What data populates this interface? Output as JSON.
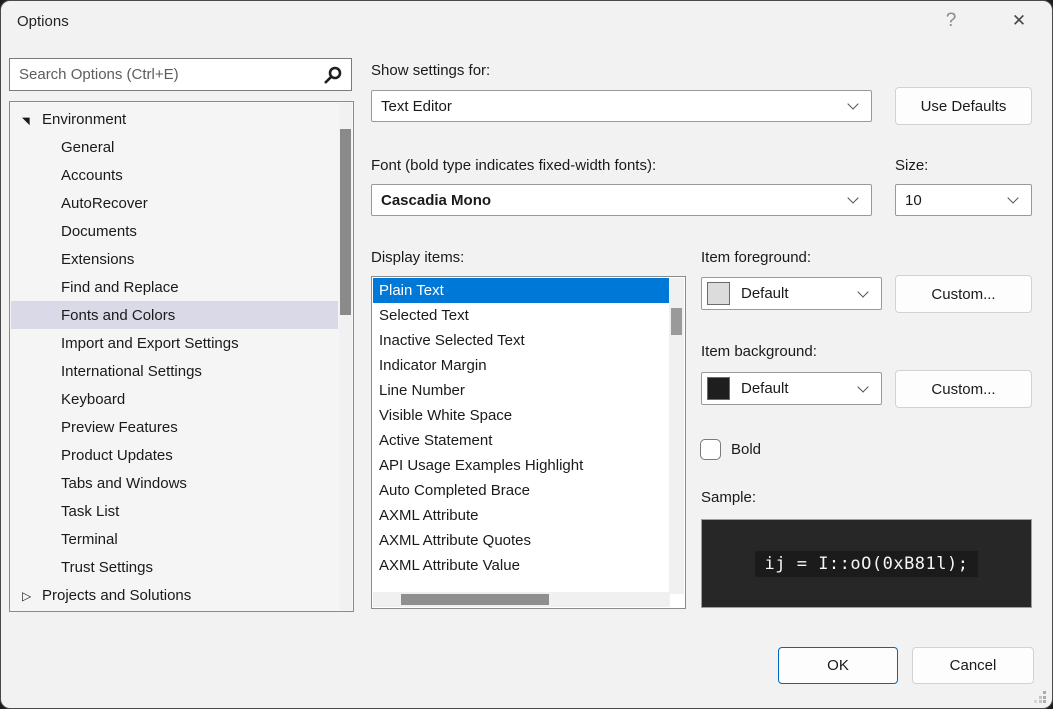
{
  "window": {
    "title": "Options",
    "help_icon": "?",
    "close_icon": "✕"
  },
  "search": {
    "placeholder": "Search Options (Ctrl+E)"
  },
  "tree": {
    "items": [
      {
        "label": "Environment",
        "level": 0,
        "arrow": "expanded",
        "selected": false
      },
      {
        "label": "General",
        "level": 1,
        "arrow": "none",
        "selected": false
      },
      {
        "label": "Accounts",
        "level": 1,
        "arrow": "none",
        "selected": false
      },
      {
        "label": "AutoRecover",
        "level": 1,
        "arrow": "none",
        "selected": false
      },
      {
        "label": "Documents",
        "level": 1,
        "arrow": "none",
        "selected": false
      },
      {
        "label": "Extensions",
        "level": 1,
        "arrow": "none",
        "selected": false
      },
      {
        "label": "Find and Replace",
        "level": 1,
        "arrow": "none",
        "selected": false
      },
      {
        "label": "Fonts and Colors",
        "level": 1,
        "arrow": "none",
        "selected": true
      },
      {
        "label": "Import and Export Settings",
        "level": 1,
        "arrow": "none",
        "selected": false
      },
      {
        "label": "International Settings",
        "level": 1,
        "arrow": "none",
        "selected": false
      },
      {
        "label": "Keyboard",
        "level": 1,
        "arrow": "none",
        "selected": false
      },
      {
        "label": "Preview Features",
        "level": 1,
        "arrow": "none",
        "selected": false
      },
      {
        "label": "Product Updates",
        "level": 1,
        "arrow": "none",
        "selected": false
      },
      {
        "label": "Tabs and Windows",
        "level": 1,
        "arrow": "none",
        "selected": false
      },
      {
        "label": "Task List",
        "level": 1,
        "arrow": "none",
        "selected": false
      },
      {
        "label": "Terminal",
        "level": 1,
        "arrow": "none",
        "selected": false
      },
      {
        "label": "Trust Settings",
        "level": 1,
        "arrow": "none",
        "selected": false
      },
      {
        "label": "Projects and Solutions",
        "level": 0,
        "arrow": "collapsed",
        "selected": false
      }
    ]
  },
  "settings": {
    "show_settings_label": "Show settings for:",
    "show_settings_value": "Text Editor",
    "use_defaults_label": "Use Defaults",
    "font_label": "Font (bold type indicates fixed-width fonts):",
    "font_value": "Cascadia Mono",
    "size_label": "Size:",
    "size_value": "10"
  },
  "display_items": {
    "label": "Display items:",
    "items": [
      {
        "label": "Plain Text",
        "selected": true
      },
      {
        "label": "Selected Text",
        "selected": false
      },
      {
        "label": "Inactive Selected Text",
        "selected": false
      },
      {
        "label": "Indicator Margin",
        "selected": false
      },
      {
        "label": "Line Number",
        "selected": false
      },
      {
        "label": "Visible White Space",
        "selected": false
      },
      {
        "label": "Active Statement",
        "selected": false
      },
      {
        "label": "API Usage Examples Highlight",
        "selected": false
      },
      {
        "label": "Auto Completed Brace",
        "selected": false
      },
      {
        "label": "AXML Attribute",
        "selected": false
      },
      {
        "label": "AXML Attribute Quotes",
        "selected": false
      },
      {
        "label": "AXML Attribute Value",
        "selected": false
      }
    ]
  },
  "item_foreground": {
    "label": "Item foreground:",
    "value": "Default",
    "swatch_color": "#dcdcdc",
    "custom_label": "Custom..."
  },
  "item_background": {
    "label": "Item background:",
    "value": "Default",
    "swatch_color": "#1e1e1e",
    "custom_label": "Custom..."
  },
  "bold_option": {
    "label": "Bold",
    "checked": false
  },
  "sample": {
    "label": "Sample:",
    "text": "ij = I::oO(0xB81l);"
  },
  "footer": {
    "ok_label": "OK",
    "cancel_label": "Cancel"
  },
  "colors": {
    "list_selection": "#0078d7",
    "tree_selection": "#d9d9e8",
    "sample_box_bg": "#272727",
    "sample_text_bg": "#1b1b1b",
    "sample_text_color": "#f5f5f5",
    "ok_border": "#0067c0"
  }
}
